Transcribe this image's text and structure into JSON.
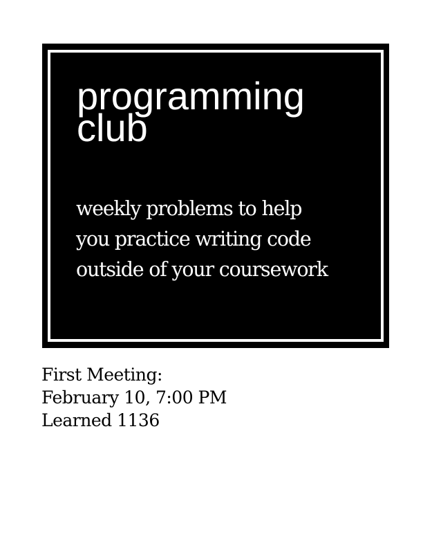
{
  "poster": {
    "title_line1": "programming",
    "title_line2": "club",
    "tagline_line1": "weekly problems to help",
    "tagline_line2": "you practice writing code",
    "tagline_line3": "outside of your coursework"
  },
  "meeting": {
    "heading": "First Meeting:",
    "date_time": "February 10, 7:00 PM",
    "location": "Learned 1136"
  },
  "colors": {
    "box_background": "#000000",
    "box_text": "#ffffff",
    "page_background": "#ffffff",
    "page_text": "#000000"
  }
}
